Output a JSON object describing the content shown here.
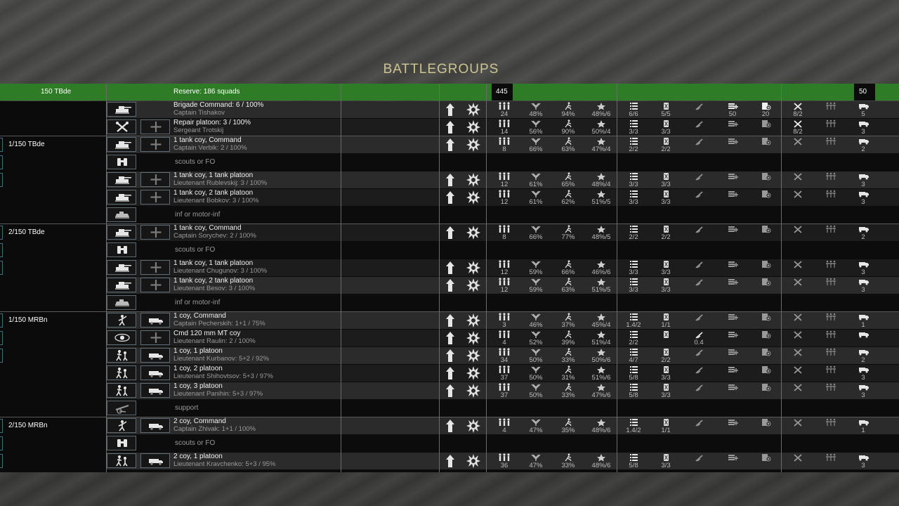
{
  "title": "BATTLEGROUPS",
  "header": {
    "unit": "150 TBde",
    "reserve": "Reserve: 186  squads",
    "count_men": "445",
    "count_vehicles": "50"
  },
  "battlegroups": [
    "1/150 TBde",
    "2/150 TBde",
    "1/150 MRBn",
    "2/150 MRBn"
  ],
  "rows": [
    {
      "kind": "unit",
      "name": "Brigade Command: 6 / 100%",
      "sub": "Captain Tishakov",
      "icon": "tank",
      "add": "none",
      "men": "24",
      "morale": "48%",
      "fitness": "94%",
      "exp": "48%/6",
      "ammo": "6/6",
      "fuel": "5/5",
      "art": "",
      "cmd": "50",
      "sup": "20",
      "rep": "8/2",
      "trans": "5"
    },
    {
      "kind": "unit",
      "name": "Repair platoon: 3 / 100%",
      "sub": "Sergeant Trotskij",
      "icon": "tools",
      "add": "plus",
      "men": "14",
      "morale": "56%",
      "fitness": "90%",
      "exp": "50%/4",
      "ammo": "3/3",
      "fuel": "3/3",
      "art": "",
      "cmd": "",
      "sup": "",
      "rep": "8/2",
      "trans": "3"
    },
    {
      "kind": "unit",
      "name": "1 tank coy, Command",
      "sub": "Captain Verbik: 2 / 100%",
      "icon": "tank",
      "add": "plus",
      "men": "8",
      "morale": "66%",
      "fitness": "63%",
      "exp": "47%/4",
      "ammo": "2/2",
      "fuel": "2/2",
      "art": "",
      "cmd": "",
      "sup": "",
      "rep": "",
      "trans": "2"
    },
    {
      "kind": "slot",
      "hint": "scouts or FO",
      "icon": "binoculars"
    },
    {
      "kind": "unit",
      "name": "1 tank coy, 1 tank platoon",
      "sub": "Lieutenant Rublevskij: 3 / 100%",
      "icon": "tank",
      "add": "plus",
      "men": "12",
      "morale": "61%",
      "fitness": "65%",
      "exp": "48%/4",
      "ammo": "3/3",
      "fuel": "3/3",
      "art": "",
      "cmd": "",
      "sup": "",
      "rep": "",
      "trans": "3"
    },
    {
      "kind": "unit",
      "name": "1 tank coy, 2 tank platoon",
      "sub": "Lieutenant Bobkov: 3 / 100%",
      "icon": "tank",
      "add": "plus",
      "men": "12",
      "morale": "61%",
      "fitness": "62%",
      "exp": "51%/5",
      "ammo": "3/3",
      "fuel": "3/3",
      "art": "",
      "cmd": "",
      "sup": "",
      "rep": "",
      "trans": "3"
    },
    {
      "kind": "slot",
      "hint": "inf or motor-inf",
      "icon": "apc"
    },
    {
      "kind": "unit",
      "name": "1 tank coy, Command",
      "sub": "Captain Sorychev: 2 / 100%",
      "icon": "tank",
      "add": "plus",
      "men": "8",
      "morale": "66%",
      "fitness": "77%",
      "exp": "48%/5",
      "ammo": "2/2",
      "fuel": "2/2",
      "art": "",
      "cmd": "",
      "sup": "",
      "rep": "",
      "trans": "2"
    },
    {
      "kind": "slot",
      "hint": "scouts or FO",
      "icon": "binoculars"
    },
    {
      "kind": "unit",
      "name": "1 tank coy, 1 tank platoon",
      "sub": "Lieutenant Chugunov: 3 / 100%",
      "icon": "tank",
      "add": "plus",
      "men": "12",
      "morale": "59%",
      "fitness": "66%",
      "exp": "46%/6",
      "ammo": "3/3",
      "fuel": "3/3",
      "art": "",
      "cmd": "",
      "sup": "",
      "rep": "",
      "trans": "3"
    },
    {
      "kind": "unit",
      "name": "1 tank coy, 2 tank platoon",
      "sub": "Lieutenant Besov: 3 / 100%",
      "icon": "tank",
      "add": "plus",
      "men": "12",
      "morale": "59%",
      "fitness": "63%",
      "exp": "51%/5",
      "ammo": "3/3",
      "fuel": "3/3",
      "art": "",
      "cmd": "",
      "sup": "",
      "rep": "",
      "trans": "3"
    },
    {
      "kind": "slot",
      "hint": "inf or motor-inf",
      "icon": "apc"
    },
    {
      "kind": "unit",
      "name": "1 coy, Command",
      "sub": "Captain Pecherskih: 1+1 / 75%",
      "icon": "officer",
      "add": "truck",
      "men": "3",
      "morale": "46%",
      "fitness": "37%",
      "exp": "45%/4",
      "ammo": "1.4/2",
      "fuel": "1/1",
      "art": "",
      "cmd": "",
      "sup": "",
      "rep": "",
      "trans": "1"
    },
    {
      "kind": "unit",
      "name": "Cmd 120 mm MT coy",
      "sub": "Lieutenant Raulin: 2 / 100%",
      "icon": "eye",
      "add": "plus",
      "men": "4",
      "morale": "52%",
      "fitness": "39%",
      "exp": "51%/4",
      "ammo": "2/2",
      "fuel": "",
      "art": "0.4",
      "cmd": "",
      "sup": "",
      "rep": "",
      "trans": ""
    },
    {
      "kind": "unit",
      "name": "1 coy, 1 platoon",
      "sub": "Lieutenant Kurbanov: 5+2 / 92%",
      "icon": "infantry",
      "add": "truck",
      "men": "34",
      "morale": "50%",
      "fitness": "33%",
      "exp": "50%/6",
      "ammo": "4/7",
      "fuel": "2/2",
      "art": "",
      "cmd": "",
      "sup": "",
      "rep": "",
      "trans": "2"
    },
    {
      "kind": "unit",
      "name": "1 coy, 2 platoon",
      "sub": "Lieutenant Shihovtsov: 5+3 / 97%",
      "icon": "infantry",
      "add": "truck",
      "men": "37",
      "morale": "50%",
      "fitness": "31%",
      "exp": "51%/6",
      "ammo": "5/8",
      "fuel": "3/3",
      "art": "",
      "cmd": "",
      "sup": "",
      "rep": "",
      "trans": "3"
    },
    {
      "kind": "unit",
      "name": "1 coy, 3 platoon",
      "sub": "Lieutenant Panihin: 5+3 / 97%",
      "icon": "infantry",
      "add": "truck",
      "men": "37",
      "morale": "50%",
      "fitness": "33%",
      "exp": "47%/6",
      "ammo": "5/8",
      "fuel": "3/3",
      "art": "",
      "cmd": "",
      "sup": "",
      "rep": "",
      "trans": "3"
    },
    {
      "kind": "slot",
      "hint": "support",
      "icon": "gun"
    },
    {
      "kind": "unit",
      "name": "2 coy, Command",
      "sub": "Captain Zhivak: 1+1 / 100%",
      "icon": "officer",
      "add": "truck",
      "men": "4",
      "morale": "47%",
      "fitness": "35%",
      "exp": "48%/6",
      "ammo": "1.4/2",
      "fuel": "1/1",
      "art": "",
      "cmd": "",
      "sup": "",
      "rep": "",
      "trans": "1"
    },
    {
      "kind": "slot",
      "hint": "scouts or FO",
      "icon": "binoculars"
    },
    {
      "kind": "unit",
      "name": "2 coy, 1 platoon",
      "sub": "Lieutenant Kravchenko: 5+3 / 95%",
      "icon": "infantry",
      "add": "truck",
      "men": "36",
      "morale": "47%",
      "fitness": "33%",
      "exp": "48%/6",
      "ammo": "5/8",
      "fuel": "3/3",
      "art": "",
      "cmd": "",
      "sup": "",
      "rep": "",
      "trans": "3"
    }
  ]
}
